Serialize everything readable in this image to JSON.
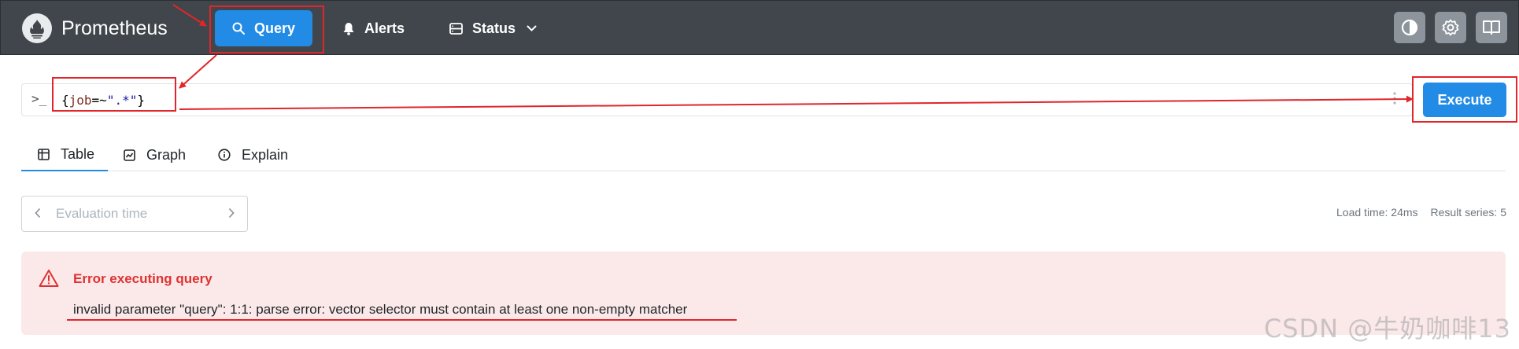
{
  "app": {
    "brand": "Prometheus"
  },
  "nav": {
    "query_label": "Query",
    "alerts_label": "Alerts",
    "status_label": "Status"
  },
  "query": {
    "prompt_icon": "terminal-prompt-icon",
    "key": "job",
    "op": "=~",
    "value": "\".*\"",
    "open_brace": "{",
    "close_brace": "}",
    "execute_label": "Execute"
  },
  "tabs": [
    {
      "label": "Table",
      "icon": "table-icon",
      "active": true
    },
    {
      "label": "Graph",
      "icon": "chart-icon",
      "active": false
    },
    {
      "label": "Explain",
      "icon": "info-icon",
      "active": false
    }
  ],
  "eval": {
    "placeholder": "Evaluation time"
  },
  "stats": {
    "load_time": "Load time: 24ms",
    "result_series": "Result series: 5"
  },
  "error": {
    "title": "Error executing query",
    "message": "invalid parameter \"query\": 1:1: parse error: vector selector must contain at least one non-empty matcher"
  },
  "watermark": "CSDN @牛奶咖啡13",
  "colors": {
    "accent": "#228be6",
    "navbar": "#40464c",
    "error": "#e03131",
    "annotation": "#e0262b"
  }
}
